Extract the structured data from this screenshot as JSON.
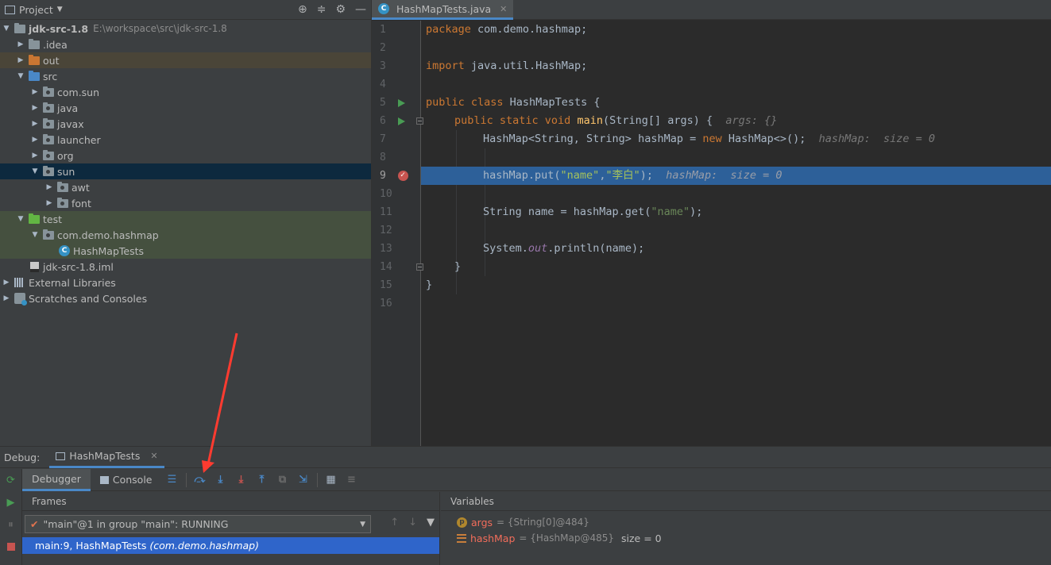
{
  "project": {
    "title": "Project",
    "tree": [
      {
        "label": "jdk-src-1.8",
        "path": "E:\\workspace\\src\\jdk-src-1.8"
      },
      {
        "label": ".idea"
      },
      {
        "label": "out"
      },
      {
        "label": "src"
      },
      {
        "label": "com.sun"
      },
      {
        "label": "java"
      },
      {
        "label": "javax"
      },
      {
        "label": "launcher"
      },
      {
        "label": "org"
      },
      {
        "label": "sun"
      },
      {
        "label": "awt"
      },
      {
        "label": "font"
      },
      {
        "label": "test"
      },
      {
        "label": "com.demo.hashmap"
      },
      {
        "label": "HashMapTests"
      },
      {
        "label": "jdk-src-1.8.iml"
      },
      {
        "label": "External Libraries"
      },
      {
        "label": "Scratches and Consoles"
      }
    ]
  },
  "editor": {
    "tab_label": "HashMapTests.java",
    "line_numbers": [
      "1",
      "2",
      "3",
      "4",
      "5",
      "6",
      "7",
      "8",
      "9",
      "10",
      "11",
      "12",
      "13",
      "14",
      "15",
      "16"
    ],
    "code": {
      "l1_kw": "package",
      "l1_rest": " com.demo.hashmap;",
      "l3_kw": "import",
      "l3_rest": " java.util.HashMap;",
      "l5_kw": "public class",
      "l5_rest": " HashMapTests {",
      "l6_kw": "public static void",
      "l6_fn": "main",
      "l6_rest": "(String[] args) {",
      "l6_hint": "args: {}",
      "l7_a": "HashMap<String, String> hashMap = ",
      "l7_kw": "new",
      "l7_b": " HashMap<>();",
      "l7_hint": "hashMap:  size = 0",
      "l9_a": "hashMap.put(",
      "l9_s1": "\"name\"",
      "l9_comma": ",",
      "l9_s2": "\"李白\"",
      "l9_b": ");",
      "l9_hint": "hashMap:  size = 0",
      "l11_a": "String name = hashMap.get(",
      "l11_s": "\"name\"",
      "l11_b": ");",
      "l13_a": "System.",
      "l13_st": "out",
      "l13_b": ".println(name);",
      "l14": "}",
      "l15": "}"
    }
  },
  "debug": {
    "label": "Debug:",
    "config_tab": "HashMapTests",
    "tabs": {
      "debugger": "Debugger",
      "console": "Console"
    },
    "frames_header": "Frames",
    "thread_selection": "\"main\"@1 in group \"main\": RUNNING",
    "frame": {
      "method": "main:9, HashMapTests",
      "package": "(com.demo.hashmap)"
    },
    "variables_header": "Variables",
    "variables": [
      {
        "name": "args",
        "value": "= {String[0]@484}",
        "extra": ""
      },
      {
        "name": "hashMap",
        "value": "= {HashMap@485}",
        "extra": "size = 0"
      }
    ]
  },
  "colors": {
    "selection": "#2d6099",
    "accent": "#4a88c7",
    "breakpoint": "#c75450",
    "annotation_arrow": "#ff3b30"
  }
}
